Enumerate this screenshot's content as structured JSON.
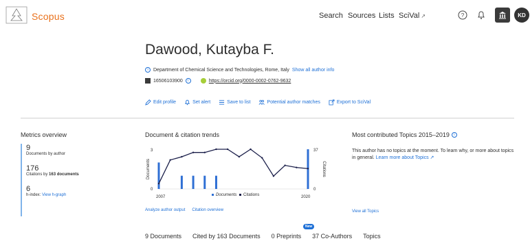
{
  "header": {
    "brand": "Scopus",
    "nav": [
      {
        "label": "Search"
      },
      {
        "label": "Sources"
      },
      {
        "label": "Lists"
      },
      {
        "label": "SciVal",
        "external": "↗"
      }
    ],
    "avatar_initials": "KD"
  },
  "profile": {
    "name": "Dawood, Kutayba F.",
    "affiliation": "Department of Chemical Science and Technologies, Rome, Italy",
    "show_all_info": "Show all author info",
    "scopus_id": "16506103900",
    "orcid": "https://orcid.org/0000-0002-0762-9632"
  },
  "actions": [
    {
      "label": "Edit profile",
      "icon": "pencil-icon"
    },
    {
      "label": "Set alert",
      "icon": "bell-icon"
    },
    {
      "label": "Save to list",
      "icon": "list-icon"
    },
    {
      "label": "Potential author matches",
      "icon": "people-icon"
    },
    {
      "label": "Export to SciVal",
      "icon": "export-icon"
    }
  ],
  "metrics": {
    "title": "Metrics overview",
    "documents_value": "9",
    "documents_label": "Documents by author",
    "citations_value": "176",
    "citations_label_prefix": "Citations by ",
    "citations_label_bold": "163 documents",
    "hindex_value": "6",
    "hindex_label": "h-index:",
    "hindex_link": "View h-graph"
  },
  "trends": {
    "title": "Document & citation trends",
    "analyze_link": "Analyze author output",
    "citation_link": "Citation overview"
  },
  "chart_data": {
    "type": "bar",
    "xlabel_left": "2007",
    "xlabel_right": "2020",
    "ylabel_left": "Documents",
    "ylabel_right": "Citations",
    "y_left_max_label": "3",
    "y_left_min_label": "0",
    "y_right_max_label": "37",
    "y_right_min_label": "0",
    "ylim_left": [
      0,
      3
    ],
    "ylim_right": [
      0,
      37
    ],
    "x": [
      2007,
      2008,
      2009,
      2010,
      2011,
      2012,
      2013,
      2014,
      2015,
      2016,
      2017,
      2018,
      2019,
      2020
    ],
    "series": [
      {
        "name": "Documents",
        "values": [
          2,
          0,
          1,
          1,
          1,
          1,
          0,
          0,
          0,
          0,
          0,
          0,
          0,
          3
        ],
        "color": "#2f6fd4"
      },
      {
        "name": "Citations",
        "values": [
          5,
          27,
          30,
          34,
          34,
          37,
          37,
          30,
          37,
          29,
          12,
          22,
          20,
          19
        ],
        "color": "#1b1f4a"
      }
    ],
    "legend": [
      "Documents",
      "Citations"
    ]
  },
  "topics": {
    "title": "Most contributed Topics 2015–2019",
    "text": "This author has no topics at the moment. To learn why, or more about topics in general.",
    "learn_more": "Learn more about Topics ↗",
    "view_all": "View all Topics"
  },
  "tabs": [
    {
      "label": "9 Documents"
    },
    {
      "label": "Cited by 163 Documents"
    },
    {
      "label": "0 Preprints"
    },
    {
      "label": "37 Co-Authors"
    },
    {
      "label": "Topics"
    }
  ],
  "badge": "New"
}
